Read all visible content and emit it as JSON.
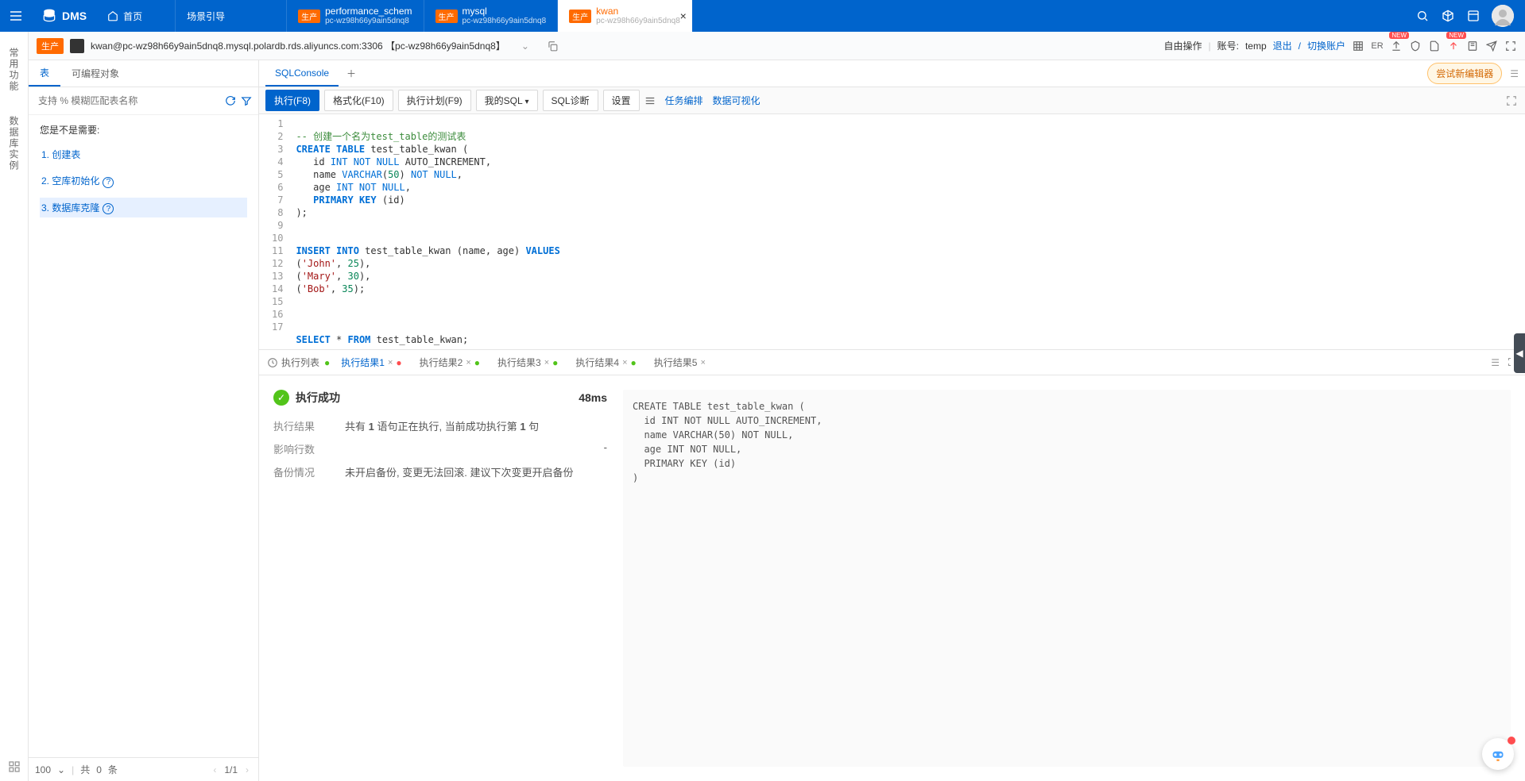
{
  "header": {
    "brand": "DMS",
    "tabs": [
      {
        "title": "首页",
        "sub": "",
        "badge": "",
        "icon": "home"
      },
      {
        "title": "场景引导",
        "sub": "",
        "badge": ""
      },
      {
        "title": "performance_schem",
        "sub": "pc-wz98h66y9ain5dnq8",
        "badge": "生产"
      },
      {
        "title": "mysql",
        "sub": "pc-wz98h66y9ain5dnq8",
        "badge": "生产"
      },
      {
        "title": "kwan",
        "sub": "pc-wz98h66y9ain5dnq8",
        "badge": "生产",
        "active": true
      }
    ]
  },
  "left_rail": {
    "item1": "常用功能",
    "item2": "数据库实例"
  },
  "breadcrumb": {
    "badge": "生产",
    "text": "kwan@pc-wz98h66y9ain5dnq8.mysql.polardb.rds.aliyuncs.com:3306 【pc-wz98h66y9ain5dnq8】",
    "mode": "自由操作",
    "account_label": "账号: ",
    "account": "temp",
    "logout": "退出",
    "switch": "切换账户",
    "er": "ER",
    "new_badge": "NEW"
  },
  "sidebar": {
    "tabs": {
      "tables": "表",
      "programmable": "可编程对象"
    },
    "search_placeholder": "支持 % 模糊匹配表名称",
    "hint": "您是不是需要:",
    "opts": {
      "create_table": "1. 创建表",
      "init_empty": "2. 空库初始化",
      "clone": "3. 数据库克隆"
    },
    "footer": {
      "page_size": "100",
      "count_prefix": "共 ",
      "count": "0",
      "count_suffix": " 条",
      "pager": "1/1"
    }
  },
  "editor_tabs": {
    "sqlconsole": "SQLConsole",
    "try_new": "尝试新编辑器"
  },
  "toolbar": {
    "run": "执行(F8)",
    "format": "格式化(F10)",
    "plan": "执行计划(F9)",
    "mysql": "我的SQL",
    "diag": "SQL诊断",
    "settings": "设置",
    "task": "任务编排",
    "viz": "数据可视化"
  },
  "sql": {
    "lines": 17,
    "l1_pre": "-- ",
    "l1_rest": "创建一个名为test_table的测试表",
    "l2_kw": "CREATE TABLE",
    "l2_rest": " test_table_kwan (",
    "l3_pre": "   id ",
    "l3_type": "INT NOT NULL",
    "l3_rest": " AUTO_INCREMENT,",
    "l4_pre": "   name ",
    "l4_type": "VARCHAR",
    "l4_open": "(",
    "l4_n": "50",
    "l4_close": ") ",
    "l4_rest": "NOT NULL",
    "l4_end": ",",
    "l5_pre": "   age ",
    "l5_type": "INT NOT NULL",
    "l5_end": ",",
    "l6_pre": "   ",
    "l6_kw": "PRIMARY KEY",
    "l6_rest": " (id)",
    "l7": ");",
    "l10_kw": "INSERT INTO",
    "l10_mid": " test_table_kwan (name, age) ",
    "l10_kw2": "VALUES",
    "l11_open": "(",
    "l11_str": "'John'",
    "l11_mid": ", ",
    "l11_n": "25",
    "l11_close": "),",
    "l12_open": "(",
    "l12_str": "'Mary'",
    "l12_mid": ", ",
    "l12_n": "30",
    "l12_close": "),",
    "l13_open": "(",
    "l13_str": "'Bob'",
    "l13_mid": ", ",
    "l13_n": "35",
    "l13_close": ");",
    "l17_kw": "SELECT",
    "l17_mid": " * ",
    "l17_kw2": "FROM",
    "l17_rest": " test_table_kwan;"
  },
  "results": {
    "history": "执行列表",
    "tabs": {
      "t1": "执行结果1",
      "t2": "执行结果2",
      "t3": "执行结果3",
      "t4": "执行结果4",
      "t5": "执行结果5"
    },
    "success_title": "执行成功",
    "duration": "48ms",
    "row1_label": "执行结果",
    "row1_val_pre": "共有 ",
    "row1_val_bold": "1",
    "row1_val_post": " 语句正在执行, 当前成功执行第 ",
    "row1_val_bold2": "1",
    "row1_val_end": " 句",
    "row2_label": "影响行数",
    "row2_val": "-",
    "row3_label": "备份情况",
    "row3_val": "未开启备份, 变更无法回滚. 建议下次变更开启备份",
    "code": "CREATE TABLE test_table_kwan (\n  id INT NOT NULL AUTO_INCREMENT,\n  name VARCHAR(50) NOT NULL,\n  age INT NOT NULL,\n  PRIMARY KEY (id)\n)"
  }
}
